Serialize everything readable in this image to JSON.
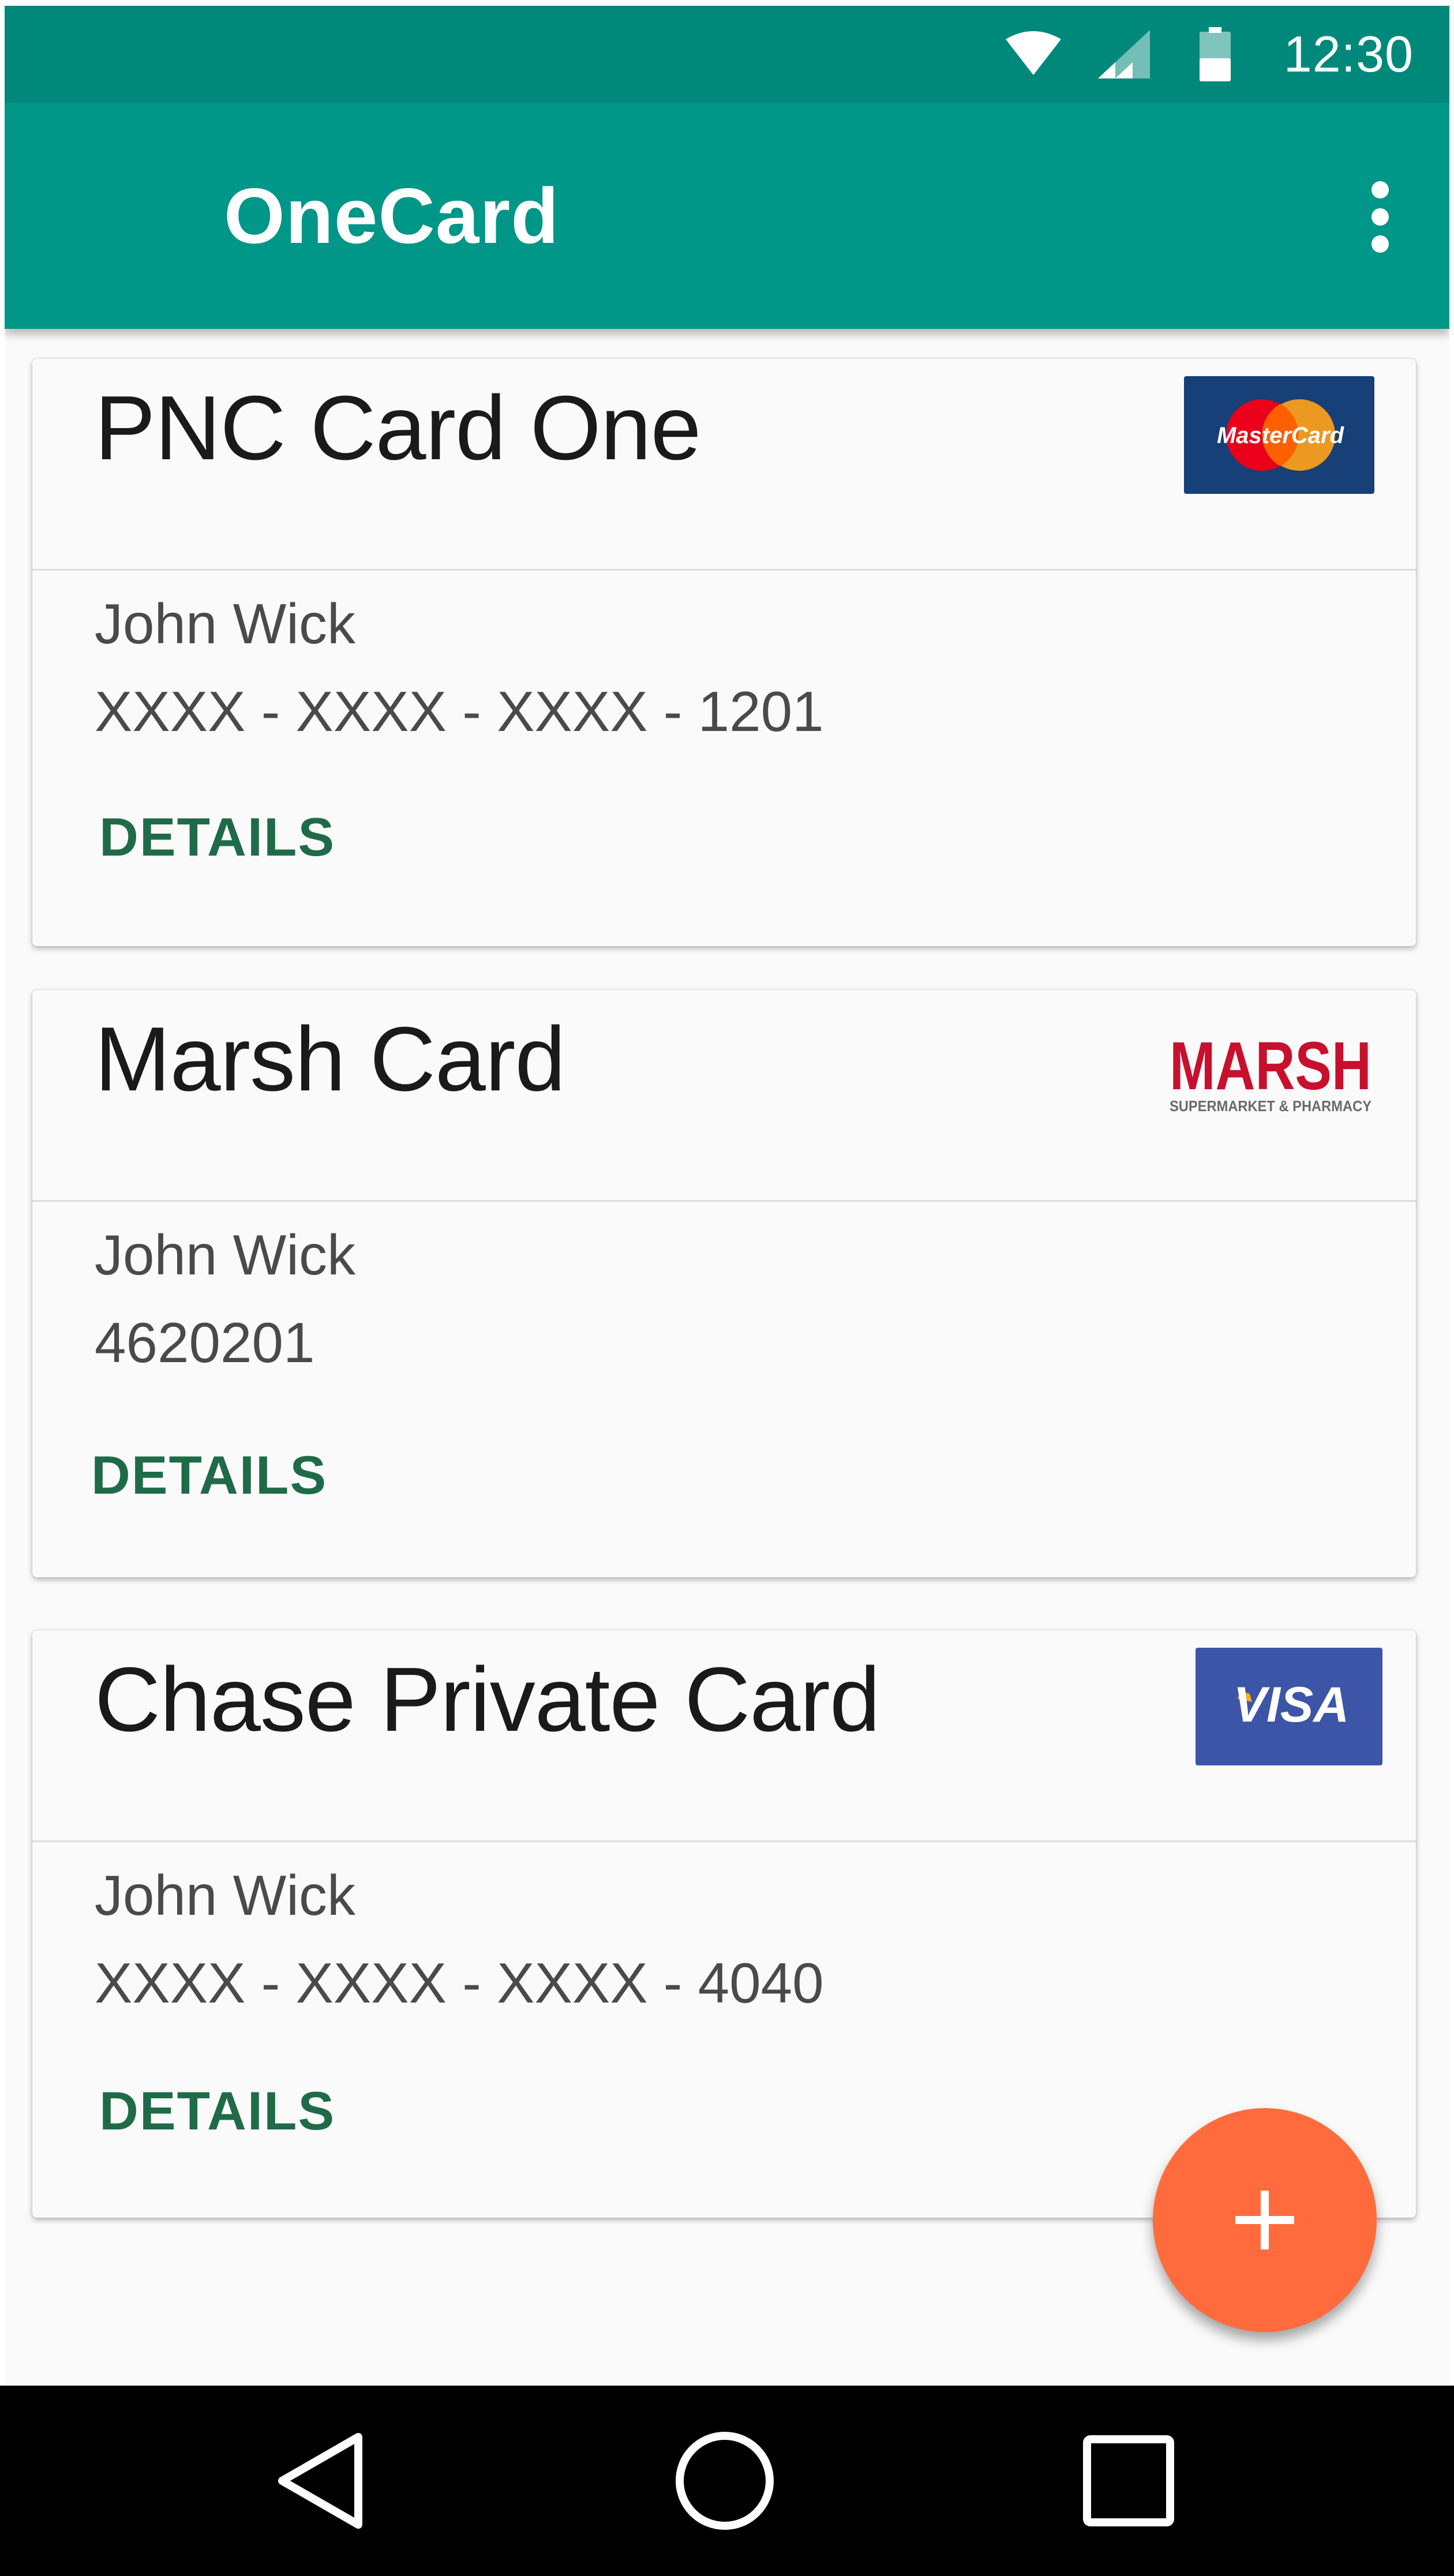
{
  "status_bar": {
    "time": "12:30",
    "icons": [
      "wifi-icon",
      "cell-signal-icon",
      "battery-icon"
    ]
  },
  "app_bar": {
    "title": "OneCard",
    "menu_icon": "more-vert-icon"
  },
  "cards": [
    {
      "title": "PNC Card One",
      "logo": "mastercard-logo",
      "logo_text": "MasterCard",
      "holder": "John Wick",
      "number": "XXXX - XXXX - XXXX - 1201",
      "details_label": "DETAILS"
    },
    {
      "title": "Marsh Card",
      "logo": "marsh-logo",
      "logo_text": "MARSH",
      "logo_subtext": "SUPERMARKET & PHARMACY",
      "holder": "John Wick",
      "number": "4620201",
      "details_label": "DETAILS"
    },
    {
      "title": "Chase Private Card",
      "logo": "visa-logo",
      "logo_text": "VISA",
      "holder": "John Wick",
      "number": "XXXX - XXXX - XXXX - 4040",
      "details_label": "DETAILS"
    }
  ],
  "fab": {
    "icon": "add-icon"
  },
  "nav_bar": {
    "icons": [
      "back-icon",
      "home-icon",
      "recents-icon"
    ]
  },
  "colors": {
    "status_bar": "#00897b",
    "app_bar": "#009688",
    "accent_text": "#1f6b48",
    "fab": "#ff6b3d"
  }
}
